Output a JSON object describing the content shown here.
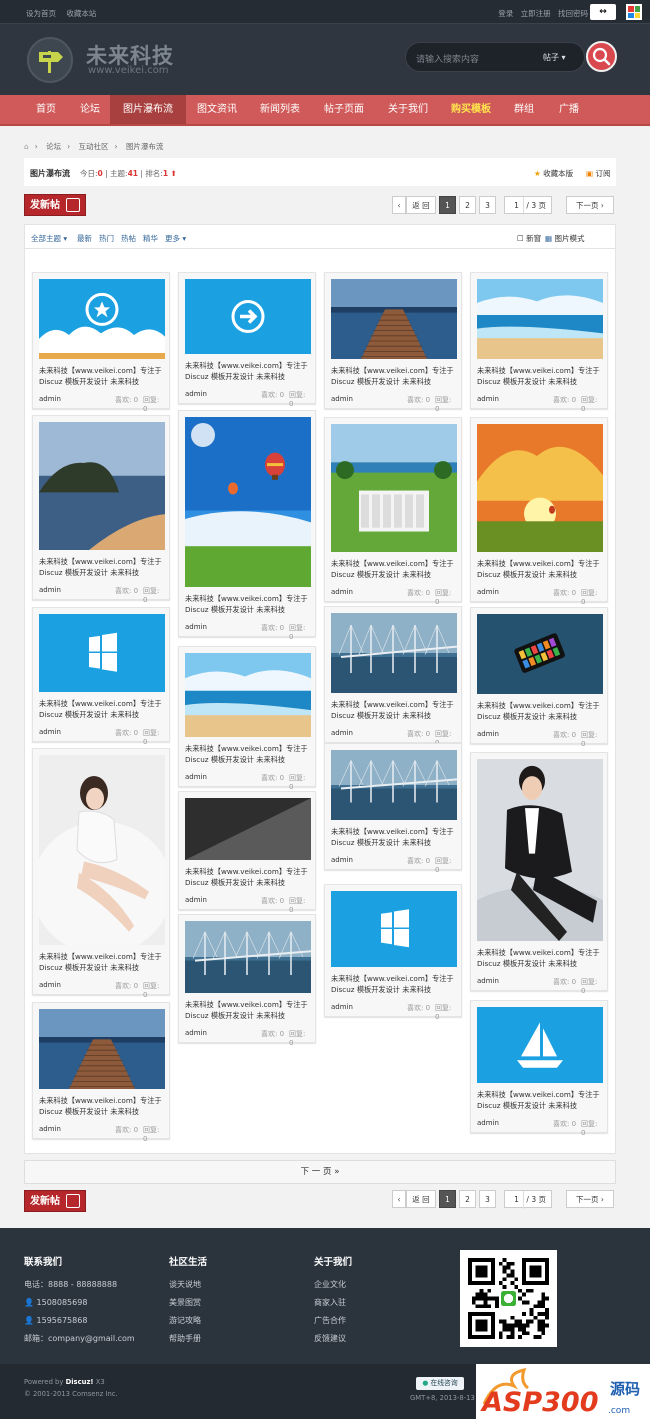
{
  "topbar": {
    "set_home": "设为首页",
    "bookmark_site": "收藏本站",
    "login": "登录",
    "register": "立即注册",
    "find_password": "找回密码",
    "switch": "↔"
  },
  "logo": {
    "cn": "未来科技",
    "en": "www.veikei.com"
  },
  "search": {
    "placeholder": "请输入搜索内容",
    "category": "帖子"
  },
  "nav": [
    "首页",
    "论坛",
    "图片瀑布流",
    "图文资讯",
    "新闻列表",
    "帖子页面",
    "关于我们",
    "购买模板",
    "群组",
    "广播"
  ],
  "breadcrumb": [
    "论坛",
    "互动社区",
    "图片瀑布流"
  ],
  "forum": {
    "title": "图片瀑布流",
    "today_label": "今日:",
    "today": "0",
    "threads_label": "主题:",
    "threads": "41",
    "rank_label": "排名:",
    "rank": "1",
    "fav": "收藏本版",
    "subscribe": "订阅"
  },
  "post_button": "发新帖",
  "pager": {
    "back": "返 回",
    "pages": [
      "1",
      "2",
      "3"
    ],
    "input": "1",
    "total": "/ 3 页",
    "next": "下一页"
  },
  "filters": {
    "all": "全部主题",
    "latest": "最新",
    "hot": "热门",
    "hotpost": "热帖",
    "digest": "精华",
    "more": "更多",
    "new_window": "新窗",
    "pic_mode": "图片模式"
  },
  "card": {
    "caption": "未来科技【www.veikei.com】专注于Discuz 模板开发设计 未来科技",
    "author": "admin",
    "likes": "喜欢: 0",
    "replies": "回复: 0"
  },
  "next_page": "下 一 页 »",
  "footer": {
    "contact": {
      "title": "联系我们",
      "phone": "电话：8888 - 88888888",
      "qq1": "1508085698",
      "qq2": "1595675868",
      "email": "邮箱：company@gmail.com"
    },
    "community": {
      "title": "社区生活",
      "items": [
        "谈天说地",
        "美景图赏",
        "游记攻略",
        "帮助手册"
      ]
    },
    "about": {
      "title": "关于我们",
      "items": [
        "企业文化",
        "商家入驻",
        "广告合作",
        "反馈建议"
      ]
    }
  },
  "copyright": {
    "powered": "Powered by",
    "discuz": "Discuz!",
    "ver": "X3",
    "comsenz": "© 2001-2013 Comsenz Inc.",
    "online": "在线咨询",
    "gmt": "GMT+8, 2013-8-13 03:"
  },
  "watermark": {
    "text": "ASP300",
    "sub": "源码"
  }
}
